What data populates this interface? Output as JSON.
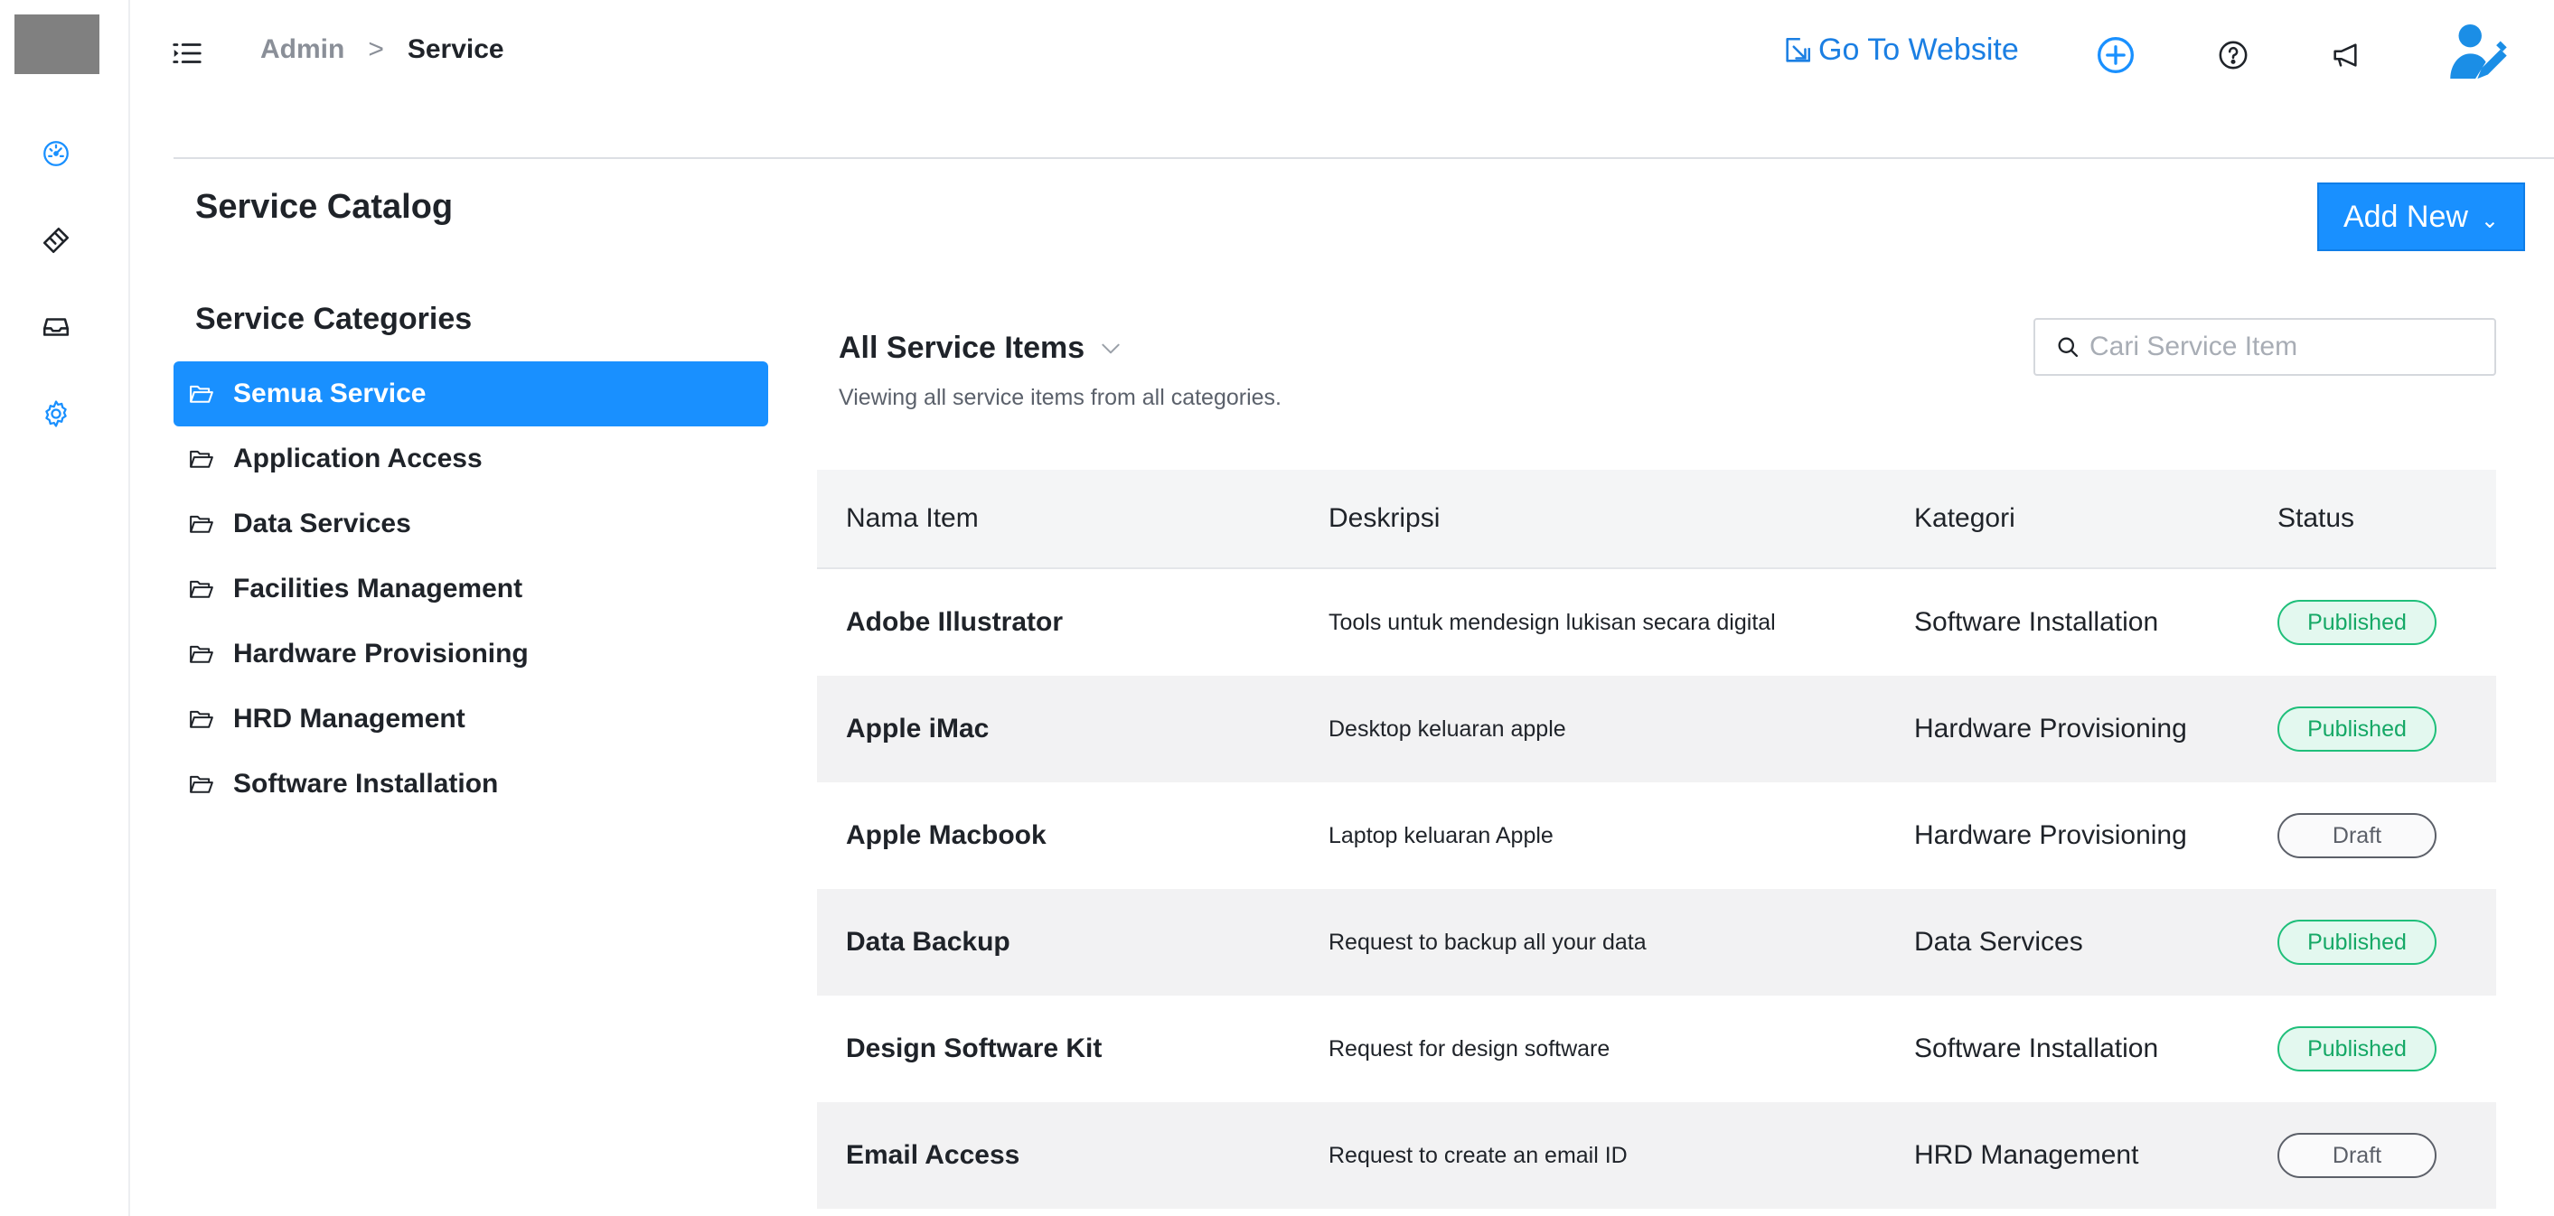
{
  "header": {
    "breadcrumb": {
      "root": "Admin",
      "separator": ">",
      "current": "Service"
    },
    "goto_label": "Go To Website",
    "accent_color": "#1990ff",
    "icons": [
      "menu-fold-icon",
      "plus-circle-icon",
      "help-icon",
      "megaphone-icon",
      "user-avatar-icon"
    ]
  },
  "sidebar": {
    "icons": [
      "dashboard-icon",
      "ticket-icon",
      "inbox-icon",
      "settings-icon"
    ]
  },
  "page": {
    "title": "Service Catalog",
    "add_new_label": "Add New",
    "add_new_chevron": "⌄"
  },
  "categories": {
    "heading": "Service Categories",
    "items": [
      {
        "label": "Semua Service",
        "active": true
      },
      {
        "label": "Application Access",
        "active": false
      },
      {
        "label": "Data Services",
        "active": false
      },
      {
        "label": "Facilities Management",
        "active": false
      },
      {
        "label": "Hardware Provisioning",
        "active": false
      },
      {
        "label": "HRD Management",
        "active": false
      },
      {
        "label": "Software Installation",
        "active": false
      }
    ]
  },
  "list": {
    "title": "All Service Items",
    "subtitle": "Viewing all service items from all categories.",
    "search_placeholder": "Cari Service Item",
    "search_value": "",
    "columns": {
      "name": "Nama Item",
      "description": "Deskripsi",
      "category": "Kategori",
      "status": "Status"
    },
    "rows": [
      {
        "name": "Adobe Illustrator",
        "description": "Tools untuk mendesign lukisan secara digital",
        "category": "Software Installation",
        "status": "Published"
      },
      {
        "name": "Apple iMac",
        "description": "Desktop keluaran apple",
        "category": "Hardware Provisioning",
        "status": "Published"
      },
      {
        "name": "Apple Macbook",
        "description": "Laptop keluaran Apple",
        "category": "Hardware Provisioning",
        "status": "Draft"
      },
      {
        "name": "Data Backup",
        "description": "Request to backup all your data",
        "category": "Data Services",
        "status": "Published"
      },
      {
        "name": "Design Software Kit",
        "description": "Request for design software",
        "category": "Software Installation",
        "status": "Published"
      },
      {
        "name": "Email Access",
        "description": "Request to create an email ID",
        "category": "HRD Management",
        "status": "Draft"
      }
    ]
  }
}
